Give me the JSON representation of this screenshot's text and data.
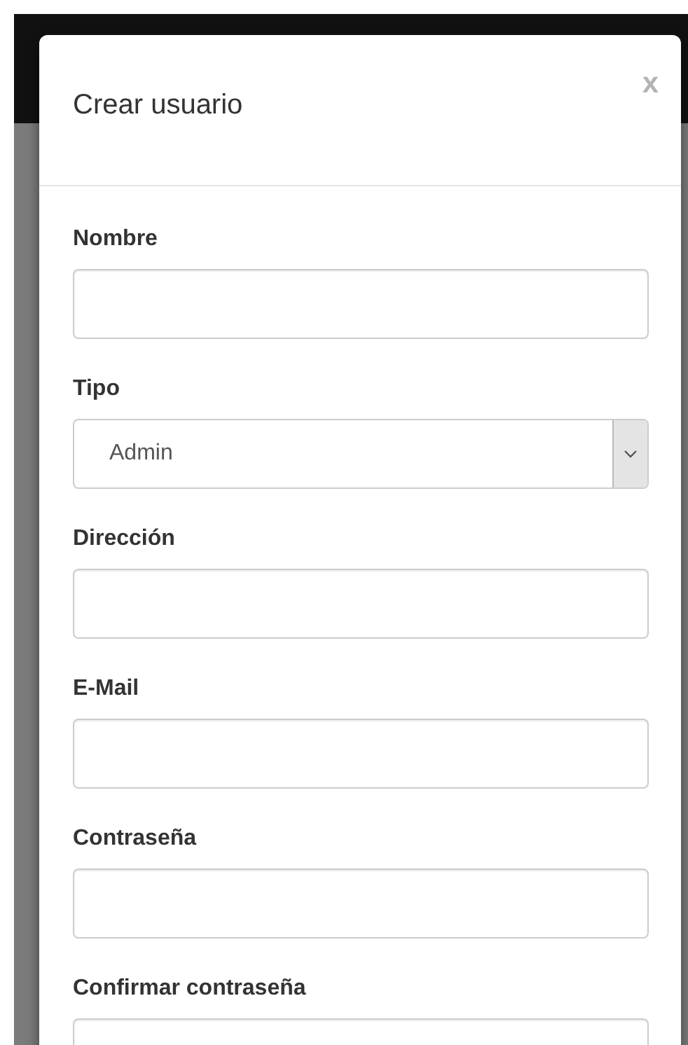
{
  "modal": {
    "title": "Crear usuario",
    "close": "x"
  },
  "fields": [
    {
      "label": "Nombre",
      "kind": "text"
    },
    {
      "label": "Tipo",
      "kind": "select",
      "value": "Admin"
    },
    {
      "label": "Dirección",
      "kind": "text"
    },
    {
      "label": "E-Mail",
      "kind": "text"
    },
    {
      "label": "Contraseña",
      "kind": "password"
    },
    {
      "label": "Confirmar contraseña",
      "kind": "password"
    }
  ]
}
